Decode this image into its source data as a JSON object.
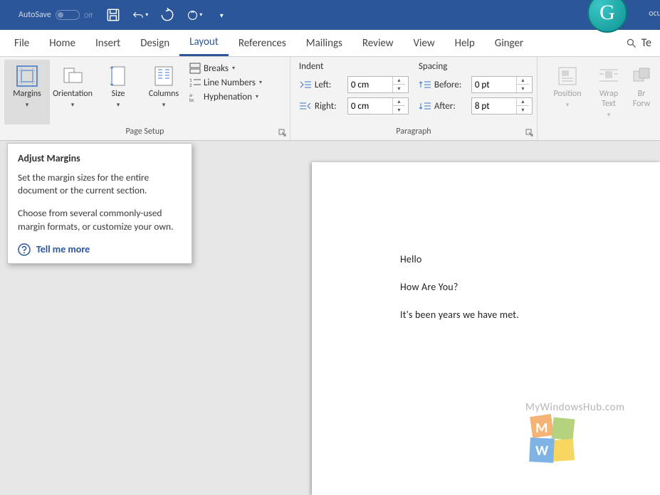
{
  "title": {
    "autosave": "AutoSave",
    "autosave_state": "Off",
    "doc_partial": "ocu"
  },
  "tabs": [
    "File",
    "Home",
    "Insert",
    "Design",
    "Layout",
    "References",
    "Mailings",
    "Review",
    "View",
    "Help",
    "Ginger"
  ],
  "active_tab_index": 4,
  "search_partial": "Te",
  "ribbon": {
    "page_setup": {
      "label": "Page Setup",
      "margins": "Margins",
      "orientation": "Orientation",
      "size": "Size",
      "columns": "Columns",
      "breaks": "Breaks",
      "line_numbers": "Line Numbers",
      "hyphenation": "Hyphenation"
    },
    "paragraph": {
      "label": "Paragraph",
      "indent": "Indent",
      "spacing": "Spacing",
      "left": "Left:",
      "right": "Right:",
      "before": "Before:",
      "after": "After:",
      "left_val": "0 cm",
      "right_val": "0 cm",
      "before_val": "0 pt",
      "after_val": "8 pt"
    },
    "arrange": {
      "position": "Position",
      "wrap": "Wrap\nText",
      "bring": "Br\nForw"
    }
  },
  "tooltip": {
    "title": "Adjust Margins",
    "p1": "Set the margin sizes for the entire document or the current section.",
    "p2": "Choose from several commonly-used margin formats, or customize your own.",
    "link": "Tell me more"
  },
  "doc_lines": [
    "Hello",
    "How Are You?",
    "It's been years we have met."
  ],
  "watermark": "MyWindowsHub.com"
}
